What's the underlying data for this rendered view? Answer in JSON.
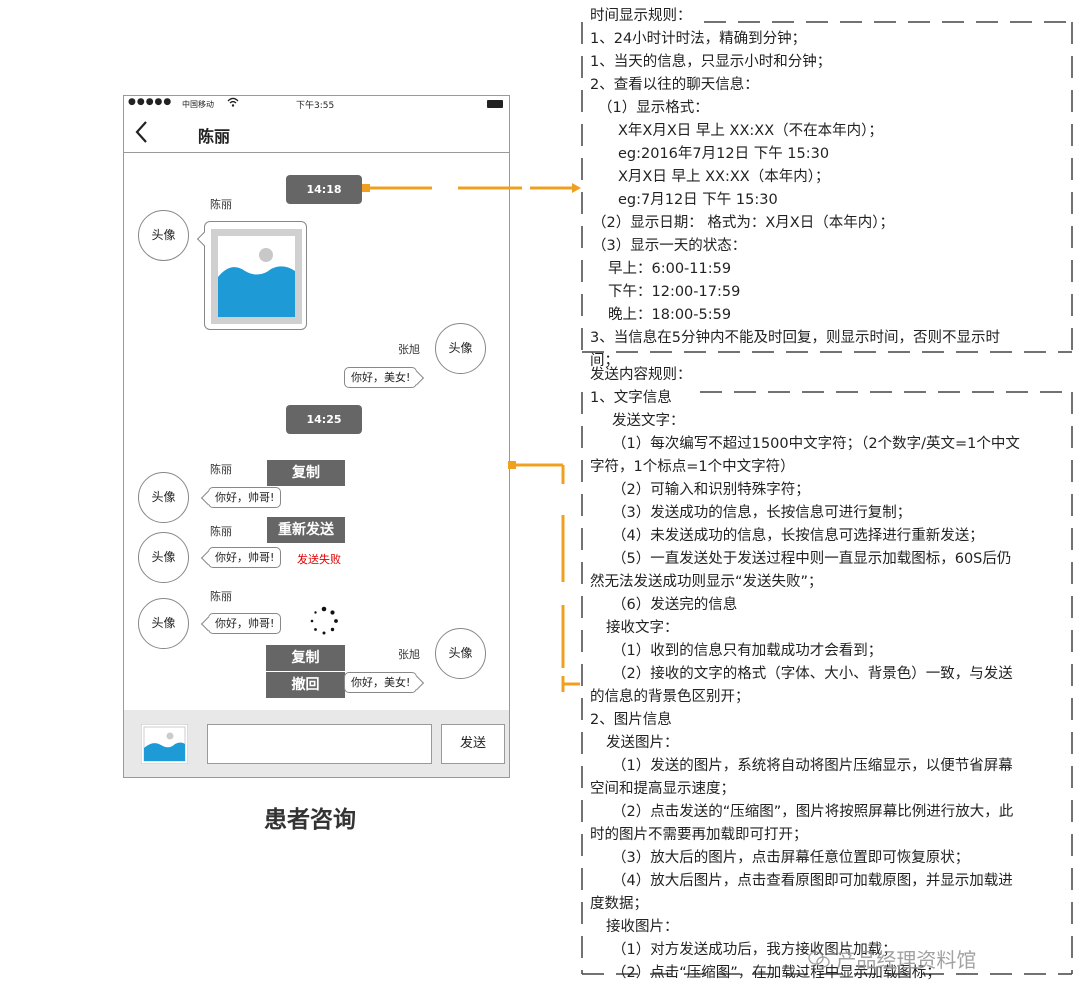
{
  "phone": {
    "status_bar": {
      "dots": "●●●●●",
      "carrier": "中国移动",
      "time": "下午3:55"
    },
    "nav": {
      "back": "‹",
      "title": "陈丽"
    },
    "messages": {
      "time1": "14:18",
      "sender1": "陈丽",
      "avatar": "头像",
      "receiver": "张旭",
      "reply_greeting": "你好，美女!",
      "time2": "14:25",
      "greeting": "你好，帅哥!",
      "copy": "复制",
      "resend": "重新发送",
      "send_failed": "发送失败",
      "recall": "撤回"
    },
    "input_bar": {
      "send_label": "发送"
    }
  },
  "caption": "患者咨询",
  "time_rules": [
    "时间显示规则：",
    "1、24小时计时法，精确到分钟；",
    "1、当天的信息，只显示小时和分钟；",
    "2、查看以往的聊天信息：",
    "（1）显示格式：",
    "X年X月X日 早上  XX:XX（不在本年内）；",
    "eg:2016年7月12日  下午  15:30",
    "X月X日  早上 XX:XX（本年内）；",
    "eg:7月12日  下午  15:30",
    "（2）显示日期：  格式为：X月X日（本年内）；",
    "（3）显示一天的状态：",
    "早上：6:00-11:59",
    "下午：12:00-17:59",
    "晚上：18:00-5:59",
    "3、当信息在5分钟内不能及时回复，则显示时间，否则不显示时",
    "间；"
  ],
  "send_rules": [
    "发送内容规则：",
    "1、文字信息",
    "发送文字：",
    "（1）每次编写不超过1500中文字符；（2个数字/英文=1个中文",
    "字符，1个标点=1个中文字符）",
    "（2）可输入和识别特殊字符；",
    "（3）发送成功的信息，长按信息可进行复制；",
    "（4）未发送成功的信息，长按信息可选择进行重新发送；",
    "（5）一直发送处于发送过程中则一直显示加载图标，60S后仍",
    "然无法发送成功则显示“发送失败”；",
    "（6）发送完的信息",
    "接收文字：",
    "（1）收到的信息只有加载成功才会看到；",
    "（2）接收的文字的格式（字体、大小、背景色）一致，与发送",
    "的信息的背景色区别开；",
    "2、图片信息",
    "发送图片：",
    "（1）发送的图片，系统将自动将图片压缩显示，以便节省屏幕",
    "空间和提高显示速度；",
    "（2）点击发送的“压缩图”，图片将按照屏幕比例进行放大，此",
    "时的图片不需要再加载即可打开；",
    "（3）放大后的图片，点击屏幕任意位置即可恢复原状；",
    "（4）放大后图片，点击查看原图即可加载原图，并显示加载进",
    "度数据；",
    "接收图片：",
    "（1）对方发送成功后，我方接收图片加载；",
    "（2）点击“压缩图”，在加载过程中显示加载图标；"
  ],
  "watermark": "产品经理资料馆",
  "colors": {
    "accent_orange": "#f0a020",
    "pill_gray": "#666666",
    "fail_red": "#e00000",
    "image_blue": "#1e9ad6"
  }
}
